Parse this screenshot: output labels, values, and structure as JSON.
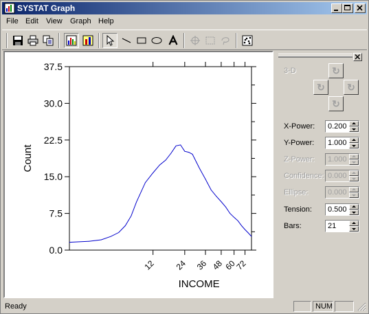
{
  "window": {
    "title": "SYSTAT Graph"
  },
  "menu": [
    "File",
    "Edit",
    "View",
    "Graph",
    "Help"
  ],
  "toolbar": {
    "tools": [
      "save-icon",
      "print-icon",
      "copy-icon",
      "chart-icon",
      "chart-data-icon",
      "select-arrow-icon",
      "line-tool-icon",
      "rectangle-tool-icon",
      "ellipse-tool-icon",
      "text-tool-icon",
      "crosshair-icon",
      "marquee-icon",
      "lasso-icon",
      "scatter-icon"
    ]
  },
  "chart_data": {
    "type": "line",
    "xlabel": "INCOME",
    "ylabel": "Count",
    "x_scale": "power 0.2",
    "x_tick_labels": [
      "12",
      "24",
      "36",
      "48",
      "60",
      "72"
    ],
    "x_ticks": [
      12,
      24,
      36,
      48,
      60,
      72
    ],
    "ylim": [
      0,
      37.5
    ],
    "y_ticks": [
      0.0,
      7.5,
      15.0,
      22.5,
      30.0,
      37.5
    ],
    "y_tick_labels": [
      "0.0",
      "7.5",
      "15.0",
      "22.5",
      "30.0",
      "37.5"
    ],
    "series": [
      {
        "color": "#0000cc",
        "x": [
          1,
          2,
          3,
          4,
          5,
          6,
          7,
          8,
          10,
          12,
          14,
          16,
          18,
          20,
          22,
          24,
          26,
          28,
          32,
          36,
          40,
          44,
          48,
          52,
          56,
          60,
          64,
          68,
          72,
          76,
          80
        ],
        "values": [
          1.6,
          1.8,
          2.1,
          2.8,
          3.6,
          5.0,
          7.0,
          9.8,
          13.8,
          15.8,
          17.4,
          18.4,
          19.8,
          21.3,
          21.5,
          20.2,
          20.0,
          19.6,
          16.8,
          14.5,
          12.3,
          11.0,
          9.9,
          8.8,
          7.5,
          6.7,
          6.0,
          5.0,
          4.2,
          3.5,
          2.8
        ]
      }
    ]
  },
  "panel": {
    "rotate_label": "3-D",
    "params": [
      {
        "label": "X-Power:",
        "value": "0.200",
        "enabled": true
      },
      {
        "label": "Y-Power:",
        "value": "1.000",
        "enabled": true
      },
      {
        "label": "Z-Power:",
        "value": "1.000",
        "enabled": false
      },
      {
        "label": "Confidence:",
        "value": "0.000",
        "enabled": false
      },
      {
        "label": "Ellipse:",
        "value": "0.000",
        "enabled": false
      },
      {
        "label": "Tension:",
        "value": "0.500",
        "enabled": true
      },
      {
        "label": "Bars:",
        "value": "21",
        "enabled": true
      }
    ]
  },
  "status": {
    "text": "Ready",
    "num": "NUM"
  }
}
